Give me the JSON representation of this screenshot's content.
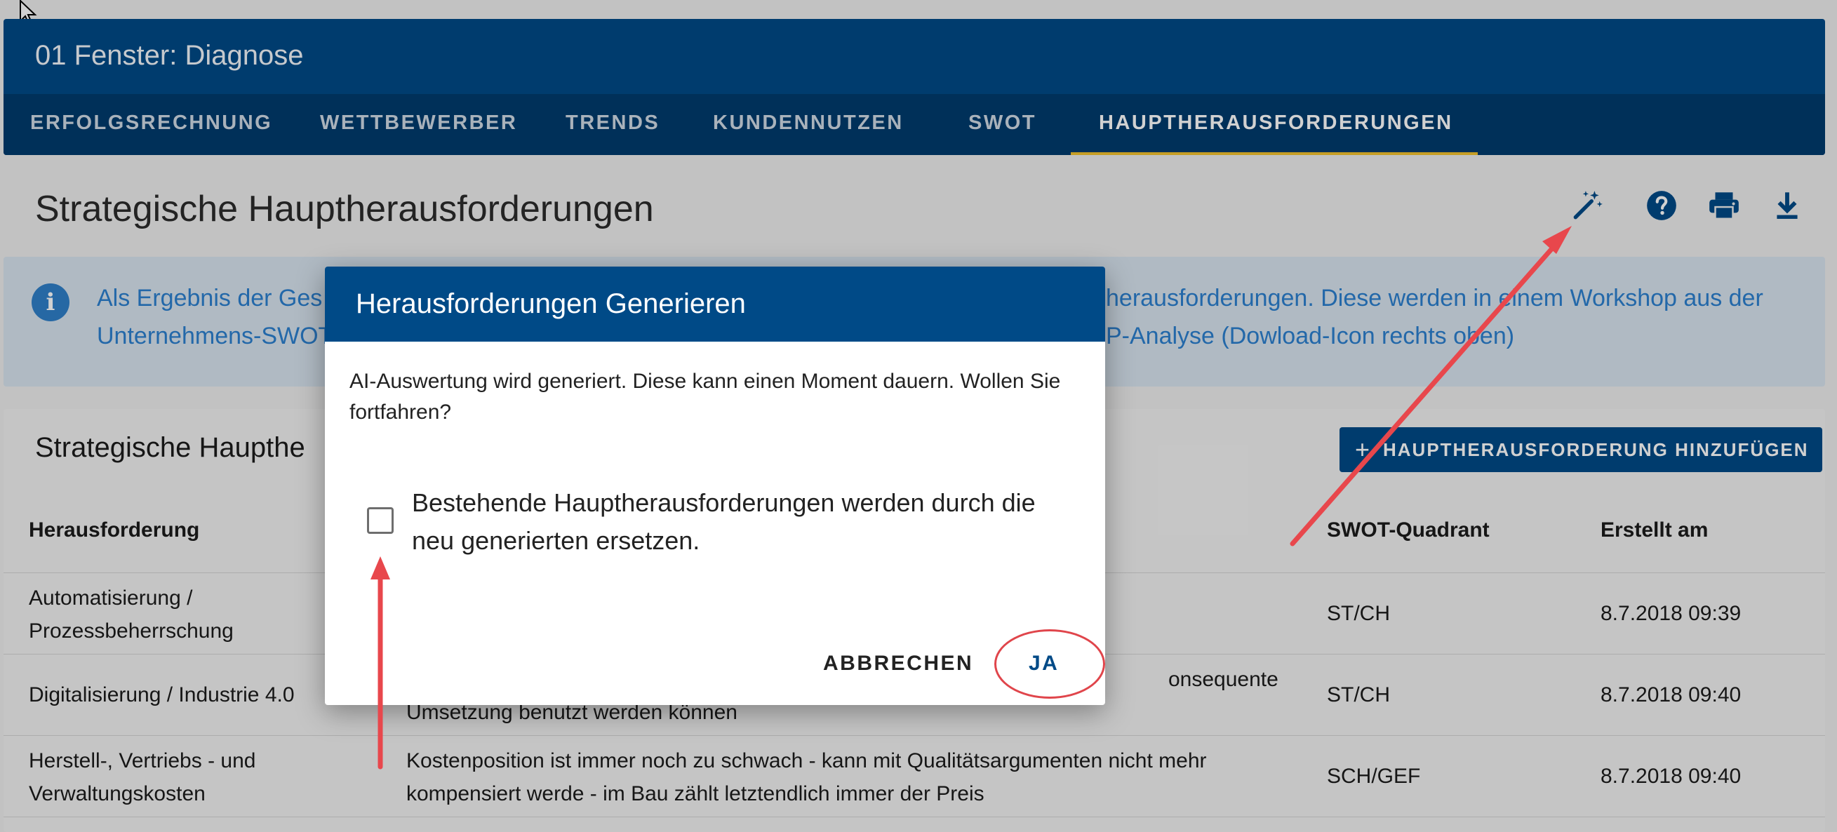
{
  "app": {
    "title": "01 Fenster: Diagnose",
    "tabs": [
      {
        "label": "ERFOLGSRECHNUNG",
        "active": false
      },
      {
        "label": "WETTBEWERBER",
        "active": false
      },
      {
        "label": "TRENDS",
        "active": false
      },
      {
        "label": "KUNDENNUTZEN",
        "active": false
      },
      {
        "label": "SWOT",
        "active": false
      },
      {
        "label": "HAUPTHERAUSFORDERUNGEN",
        "active": true
      }
    ]
  },
  "page": {
    "title": "Strategische Hauptherausforderungen",
    "tools": [
      "magic-wand-icon",
      "help-icon",
      "print-icon",
      "download-icon"
    ]
  },
  "info": {
    "line1_left": "Als Ergebnis der Ges",
    "line1_right": "herausforderungen. Diese werden in einem Workshop aus der",
    "line2_left": "Unternehmens-SWOT",
    "line2_right": "P-Analyse (Dowload-Icon rechts oben)"
  },
  "card": {
    "title": "Strategische Haupthe",
    "add_button": "HAUPTHERAUSFORDERUNG HINZUFÜGEN",
    "columns": {
      "challenge": "Herausforderung",
      "quadrant": "SWOT-Quadrant",
      "created": "Erstellt am"
    },
    "rows": [
      {
        "challenge": "Automatisierung / Prozessbeherrschung",
        "description": "",
        "quadrant": "ST/CH",
        "created": "8.7.2018 09:39"
      },
      {
        "challenge": "Digitalisierung / Industrie 4.0",
        "description_line1": "onsequente",
        "description_line2": "Umsetzung benutzt werden können",
        "quadrant": "ST/CH",
        "created": "8.7.2018 09:40"
      },
      {
        "challenge": "Herstell-, Vertriebs - und Verwaltungskosten",
        "description": "Kostenposition ist immer noch zu schwach - kann mit Qualitätsargumenten nicht mehr kompensiert werde - im Bau zählt letztendlich immer der Preis",
        "quadrant": "SCH/GEF",
        "created": "8.7.2018 09:40"
      }
    ]
  },
  "dialog": {
    "title": "Herausforderungen Generieren",
    "message": "AI-Auswertung wird generiert. Diese kann einen Moment dauern. Wollen Sie fortfahren?",
    "checkbox_label": "Bestehende Hauptherausforderungen werden durch die neu generierten ersetzen.",
    "checkbox_checked": false,
    "cancel_label": "ABBRECHEN",
    "confirm_label": "JA"
  },
  "colors": {
    "primary": "#004a87",
    "tab_indicator": "#f2c12e",
    "info_text": "#2b7fcf",
    "annotation": "#e0454b"
  }
}
